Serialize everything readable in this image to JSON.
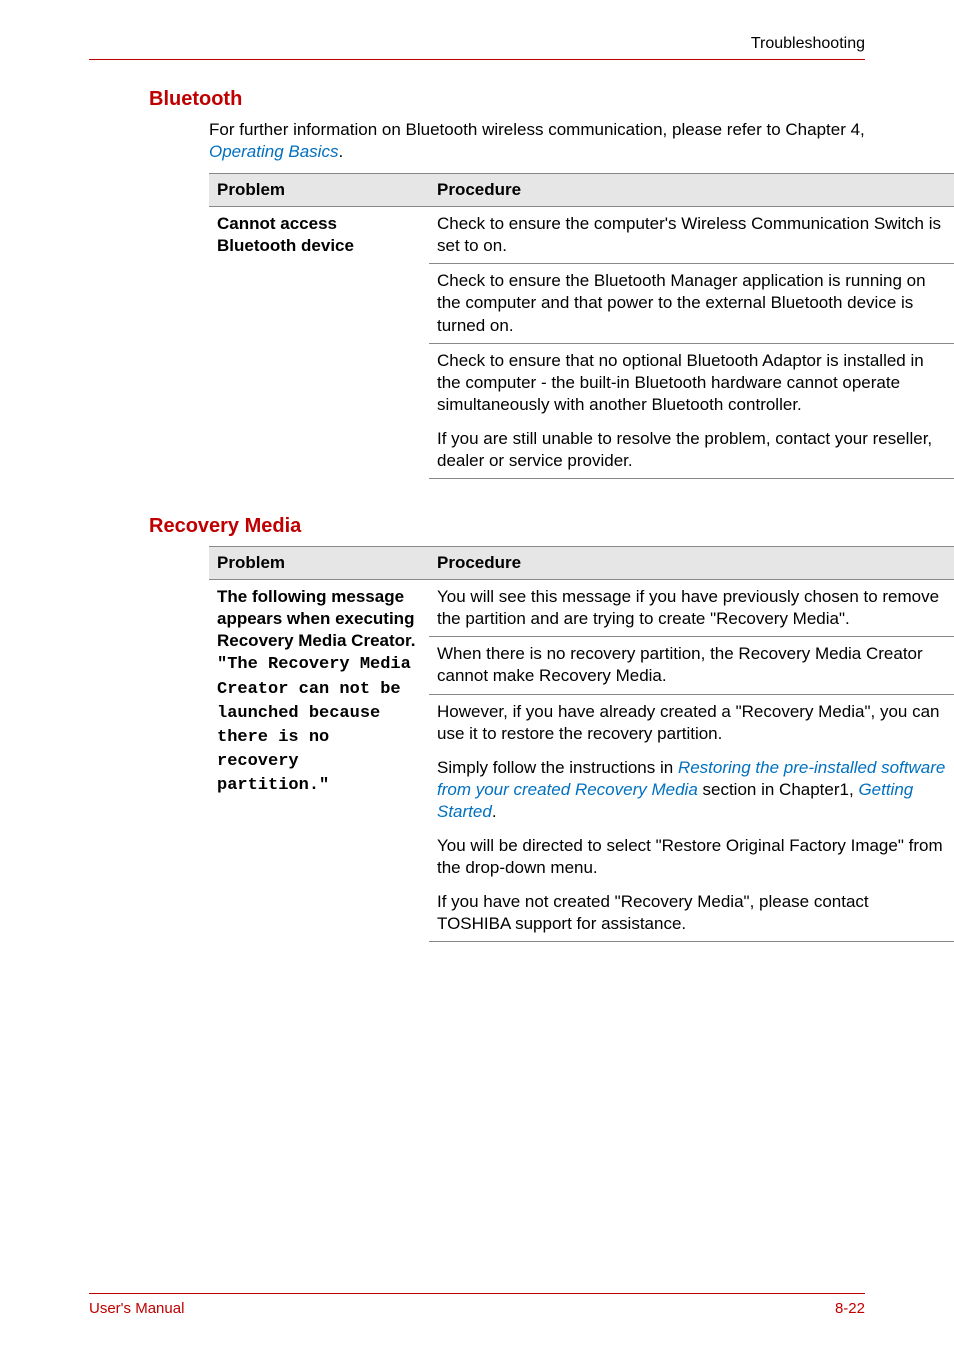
{
  "header": {
    "label": "Troubleshooting"
  },
  "bluetooth": {
    "heading": "Bluetooth",
    "intro_prefix": "For further information on Bluetooth wireless communication, please refer to Chapter 4, ",
    "intro_link": "Operating Basics",
    "intro_suffix": ".",
    "col_problem": "Problem",
    "col_procedure": "Procedure",
    "problem": "Cannot access Bluetooth device",
    "proc1": "Check to ensure the computer's Wireless Communication Switch is set to on.",
    "proc2": "Check to ensure the Bluetooth Manager application is running on the computer and that power to the external Bluetooth device is turned on.",
    "proc3": "Check to ensure that no optional Bluetooth Adaptor is installed in the computer - the built-in Bluetooth hardware cannot operate simultaneously with another Bluetooth controller.",
    "proc4": "If you are still unable to resolve the problem, contact your reseller, dealer or service provider."
  },
  "recovery": {
    "heading": "Recovery Media",
    "col_problem": "Problem",
    "col_procedure": "Procedure",
    "problem_part1": "The following message appears when executing Recovery Media Creator.",
    "problem_part2": "\"The Recovery Media Creator can not be launched because there is no recovery partition.\"",
    "proc1": "You will see this message if you have previously chosen to remove the partition and are trying to create \"Recovery Media\".",
    "proc2": "When there is no recovery partition, the Recovery Media Creator cannot make Recovery Media.",
    "proc3": "However, if you have already created a \"Recovery Media\", you can use it to restore the recovery partition.",
    "proc4_prefix": "Simply follow the instructions in ",
    "proc4_link1": "Restoring the pre-installed software from your created Recovery Media",
    "proc4_mid": " section in Chapter1, ",
    "proc4_link2": "Getting Started",
    "proc4_suffix": ".",
    "proc5": "You will be directed to select \"Restore Original Factory Image\" from the drop-down menu.",
    "proc6": "If you have not created \"Recovery Media\", please contact TOSHIBA support for assistance."
  },
  "footer": {
    "left": "User's Manual",
    "right": "8-22"
  }
}
